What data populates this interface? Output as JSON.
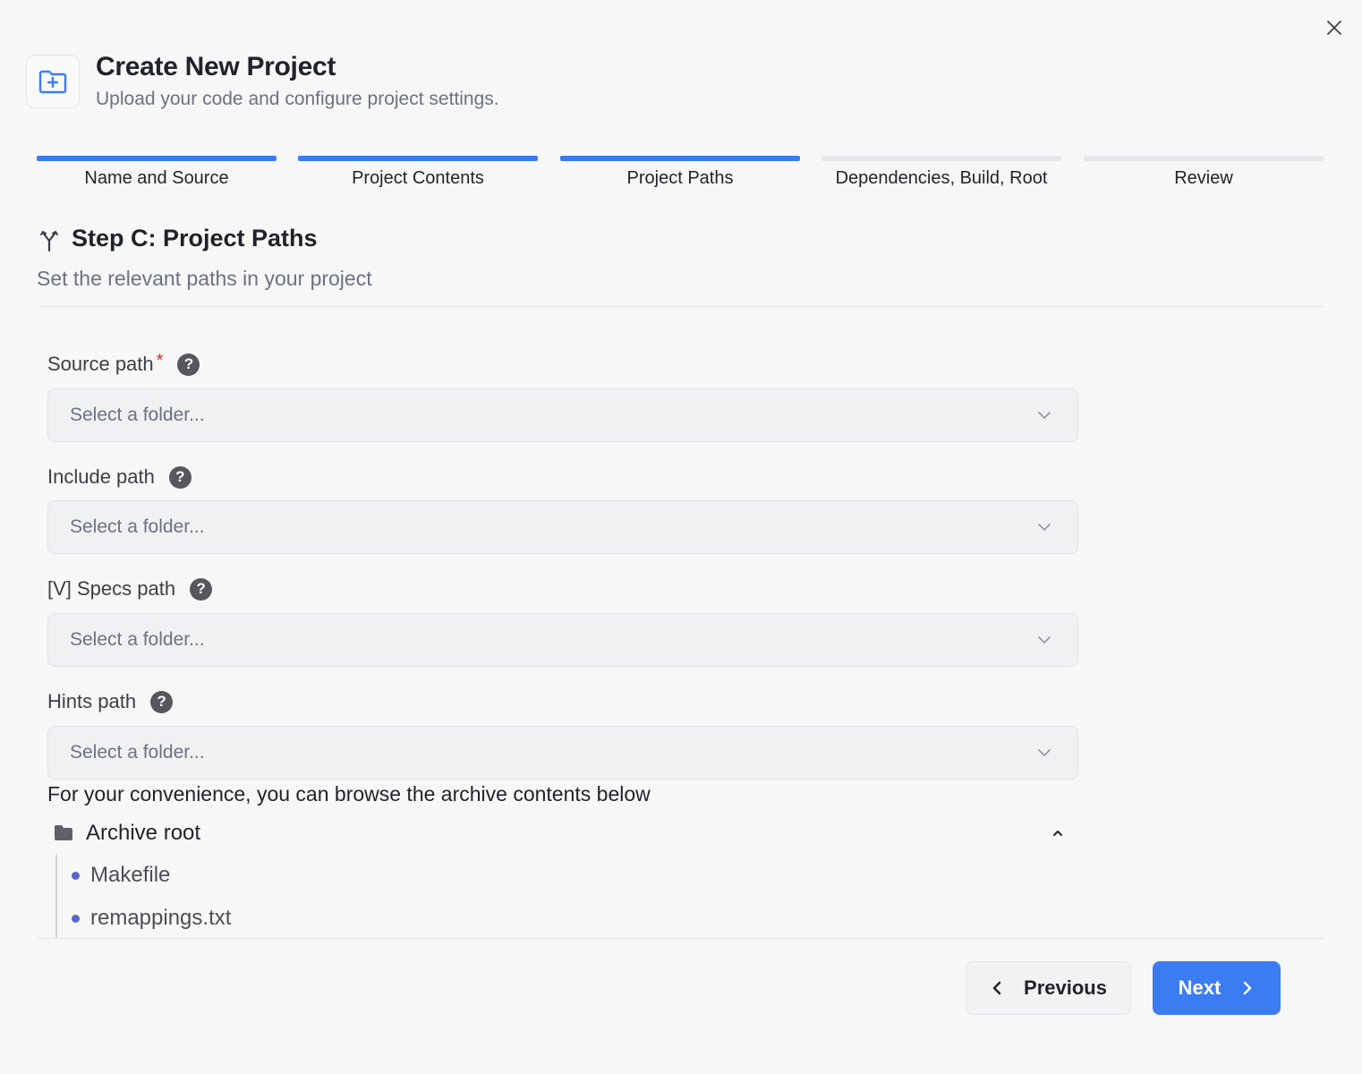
{
  "dialog": {
    "title": "Create New Project",
    "subtitle": "Upload your code and configure project settings."
  },
  "steps": [
    {
      "label": "Name and Source",
      "completed": true
    },
    {
      "label": "Project Contents",
      "completed": true
    },
    {
      "label": "Project Paths",
      "completed": true
    },
    {
      "label": "Dependencies, Build, Root",
      "completed": false
    },
    {
      "label": "Review",
      "completed": false
    }
  ],
  "section": {
    "title": "Step C: Project Paths",
    "description": "Set the relevant paths in your project"
  },
  "fields": [
    {
      "label": "Source path",
      "required": "*",
      "placeholder": "Select a folder..."
    },
    {
      "label": "Include path",
      "placeholder": "Select a folder..."
    },
    {
      "label": "[V] Specs path",
      "placeholder": "Select a folder..."
    },
    {
      "label": "Hints path",
      "placeholder": "Select a folder..."
    }
  ],
  "browser": {
    "intro": "For your convenience, you can browse the archive contents below",
    "root": "Archive root",
    "items": [
      "Makefile",
      "remappings.txt"
    ]
  },
  "footer": {
    "previous_label": "Previous",
    "next_label": "Next"
  },
  "colors": {
    "accent": "#3b7bf2",
    "required": "#d93025",
    "tree_bullet": "#5865c9"
  },
  "icons": {
    "close": "close-icon",
    "header": "folder-plus-icon",
    "section": "git-fork-icon",
    "help": "question-circle-icon",
    "dropdown": "chevron-down-icon",
    "tree_root": "folder-icon",
    "tree_toggle": "chevron-up-icon",
    "previous": "chevron-left-icon",
    "next": "chevron-right-icon"
  }
}
